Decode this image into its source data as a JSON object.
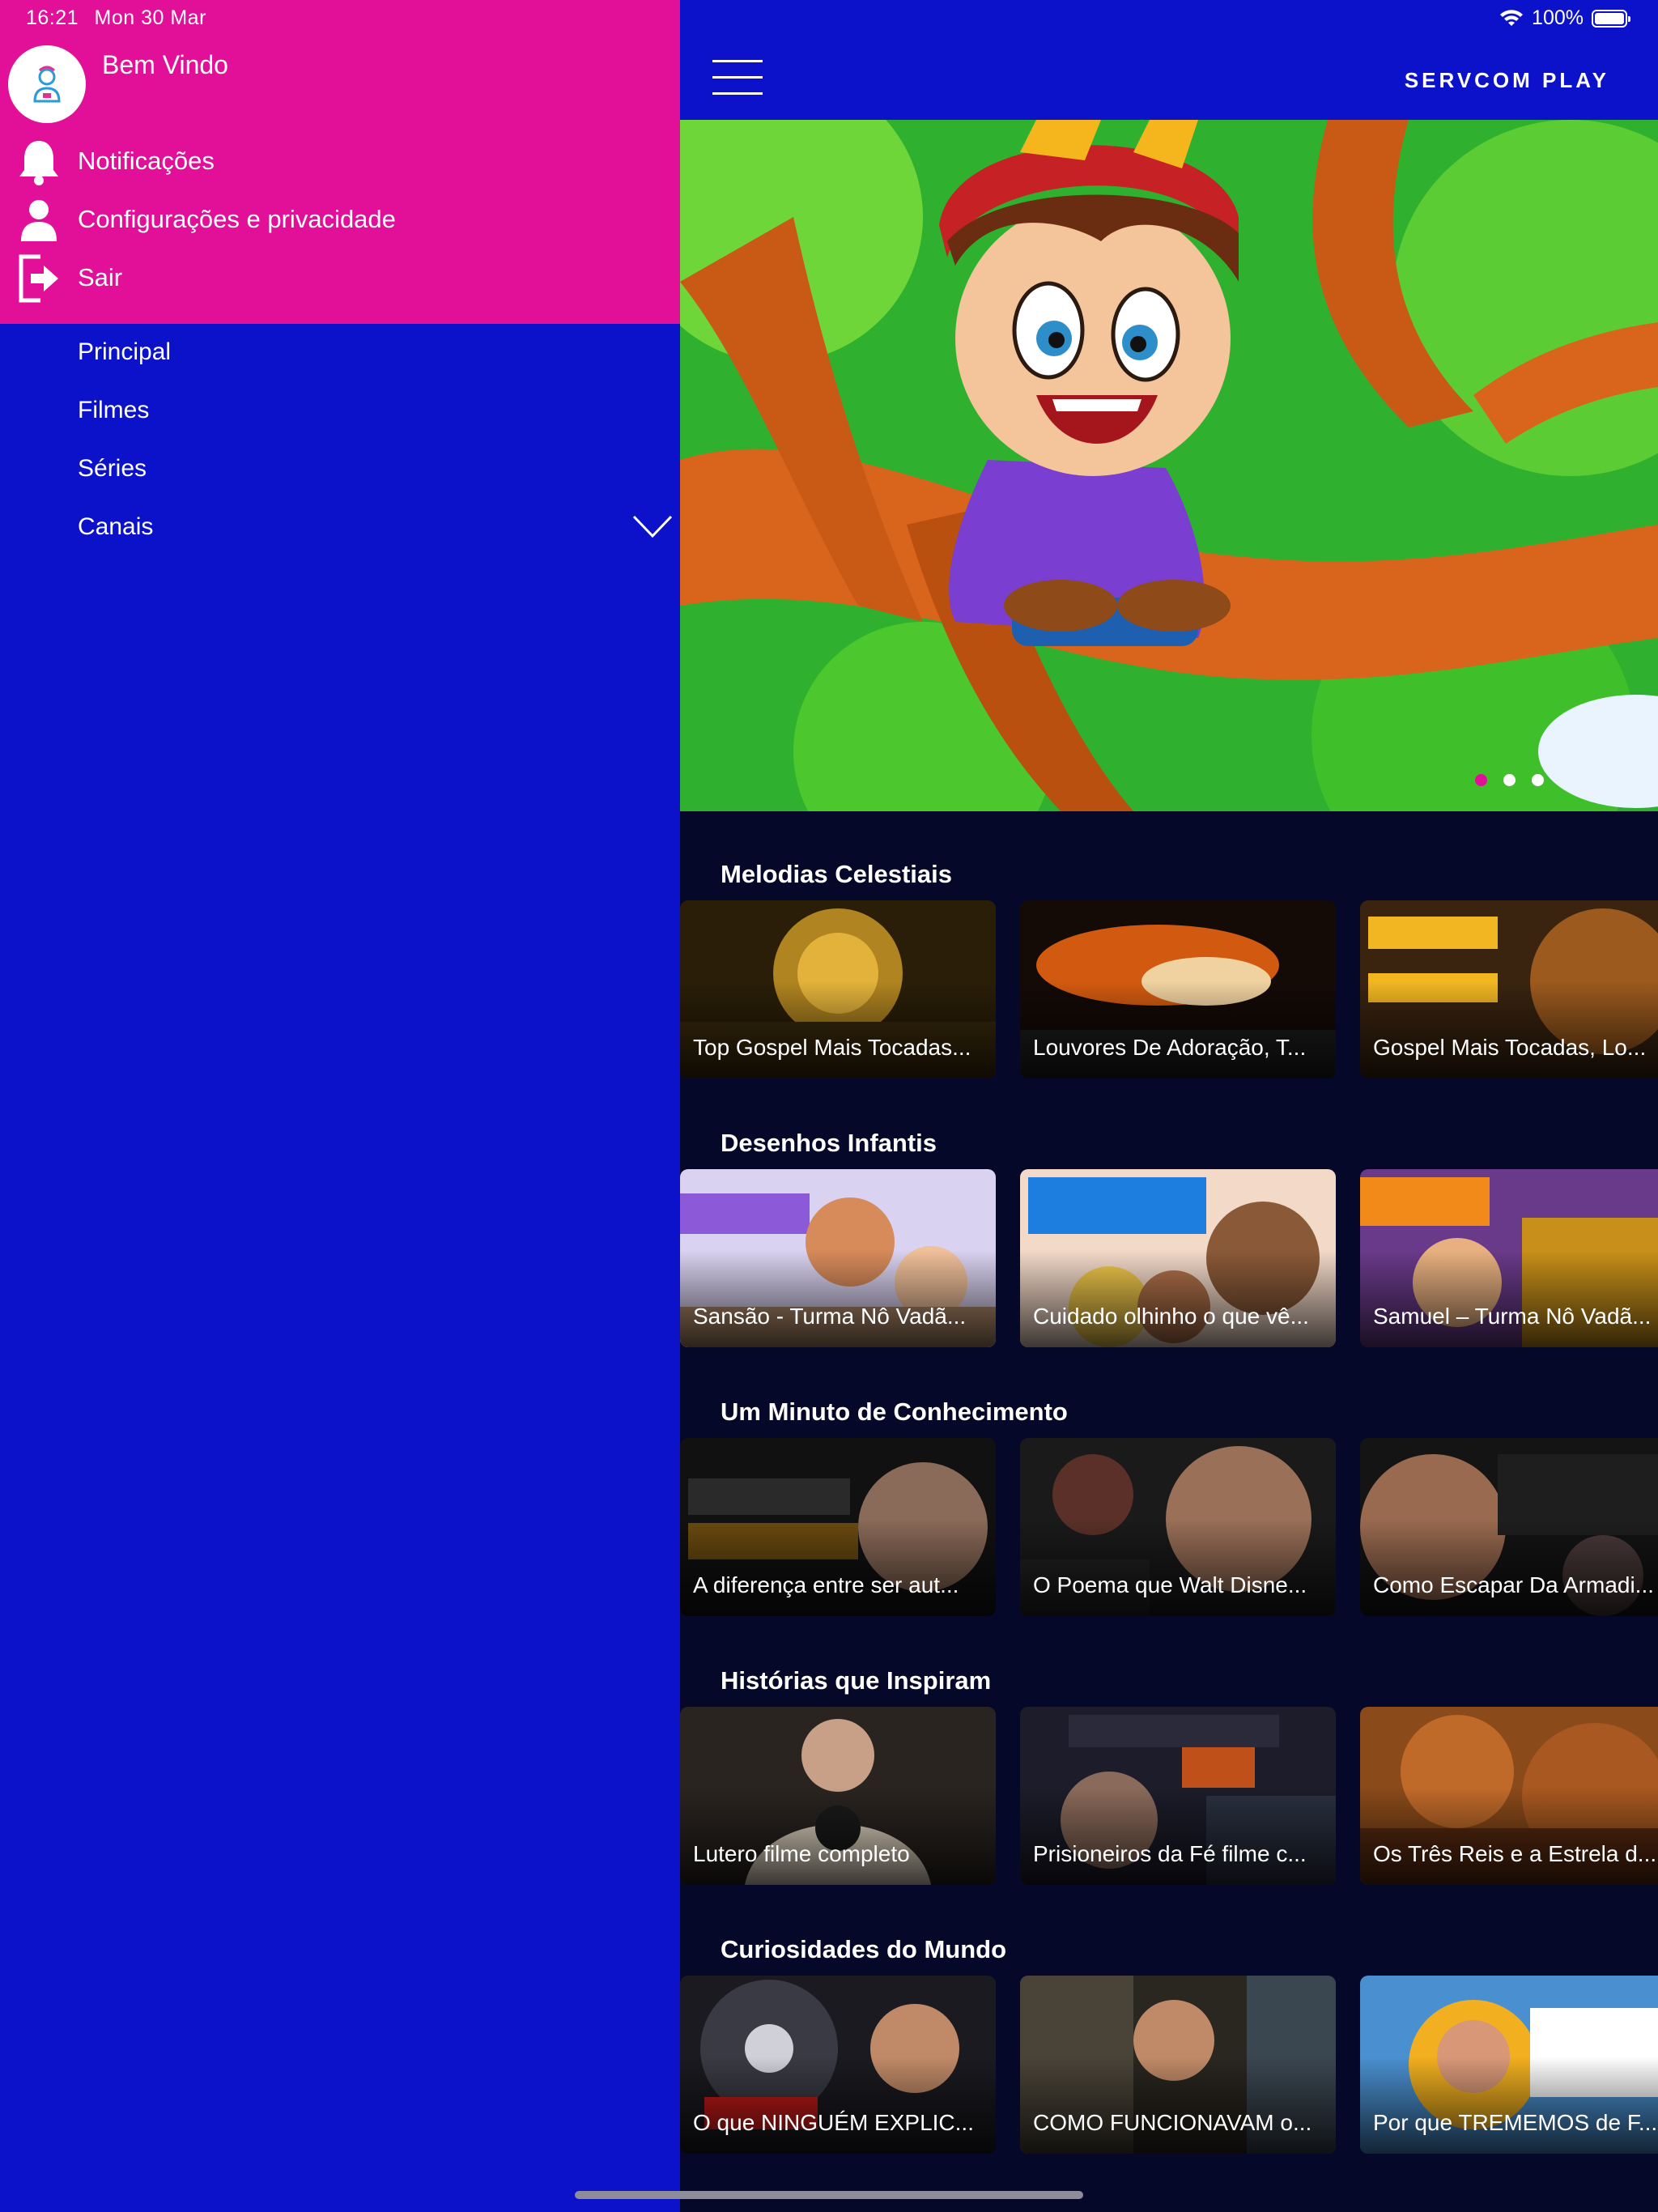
{
  "status_bar": {
    "time": "16:21",
    "date": "Mon 30 Mar",
    "battery": "100%",
    "battery_level": 1.0
  },
  "drawer": {
    "welcome": "Bem Vindo",
    "actions": [
      {
        "label": "Notificações",
        "icon": "bell-icon"
      },
      {
        "label": "Configurações e privacidade",
        "icon": "person-icon"
      },
      {
        "label": "Sair",
        "icon": "logout-icon"
      }
    ],
    "nav": [
      {
        "label": "Principal"
      },
      {
        "label": "Filmes"
      },
      {
        "label": "Séries"
      },
      {
        "label": "Canais",
        "expandable": true
      }
    ]
  },
  "header": {
    "brand": "SERVCOM PLAY"
  },
  "hero": {
    "slides": 3,
    "active_slide": 0
  },
  "sections": [
    {
      "title": "Melodias Celestiais",
      "items": [
        {
          "caption": "Top Gospel Mais Tocadas..."
        },
        {
          "caption": "Louvores De Adoração, T..."
        },
        {
          "caption": "Gospel Mais Tocadas, Lo..."
        }
      ]
    },
    {
      "title": "Desenhos Infantis",
      "items": [
        {
          "caption": "Sansão - Turma Nô Vadã..."
        },
        {
          "caption": "Cuidado olhinho o que vê..."
        },
        {
          "caption": "Samuel – Turma Nô Vadã..."
        }
      ]
    },
    {
      "title": "Um Minuto de Conhecimento",
      "items": [
        {
          "caption": "A diferença entre ser aut..."
        },
        {
          "caption": "O Poema que Walt Disne..."
        },
        {
          "caption": "Como Escapar Da Armadi..."
        }
      ]
    },
    {
      "title": "Histórias que Inspiram",
      "items": [
        {
          "caption": "Lutero filme completo"
        },
        {
          "caption": "Prisioneiros da Fé filme c..."
        },
        {
          "caption": "Os Três Reis e a Estrela d..."
        }
      ]
    },
    {
      "title": "Curiosidades do Mundo",
      "items": [
        {
          "caption": "O que NINGUÉM EXPLIC..."
        },
        {
          "caption": "COMO FUNCIONAVAM o..."
        },
        {
          "caption": "Por que TREMEMOS de F..."
        }
      ]
    }
  ],
  "colors": {
    "drawer_top": "#e20f98",
    "drawer": "#0b12c9",
    "header": "#0b12c9",
    "content_bg": "#050828",
    "accent": "#e20f98"
  }
}
